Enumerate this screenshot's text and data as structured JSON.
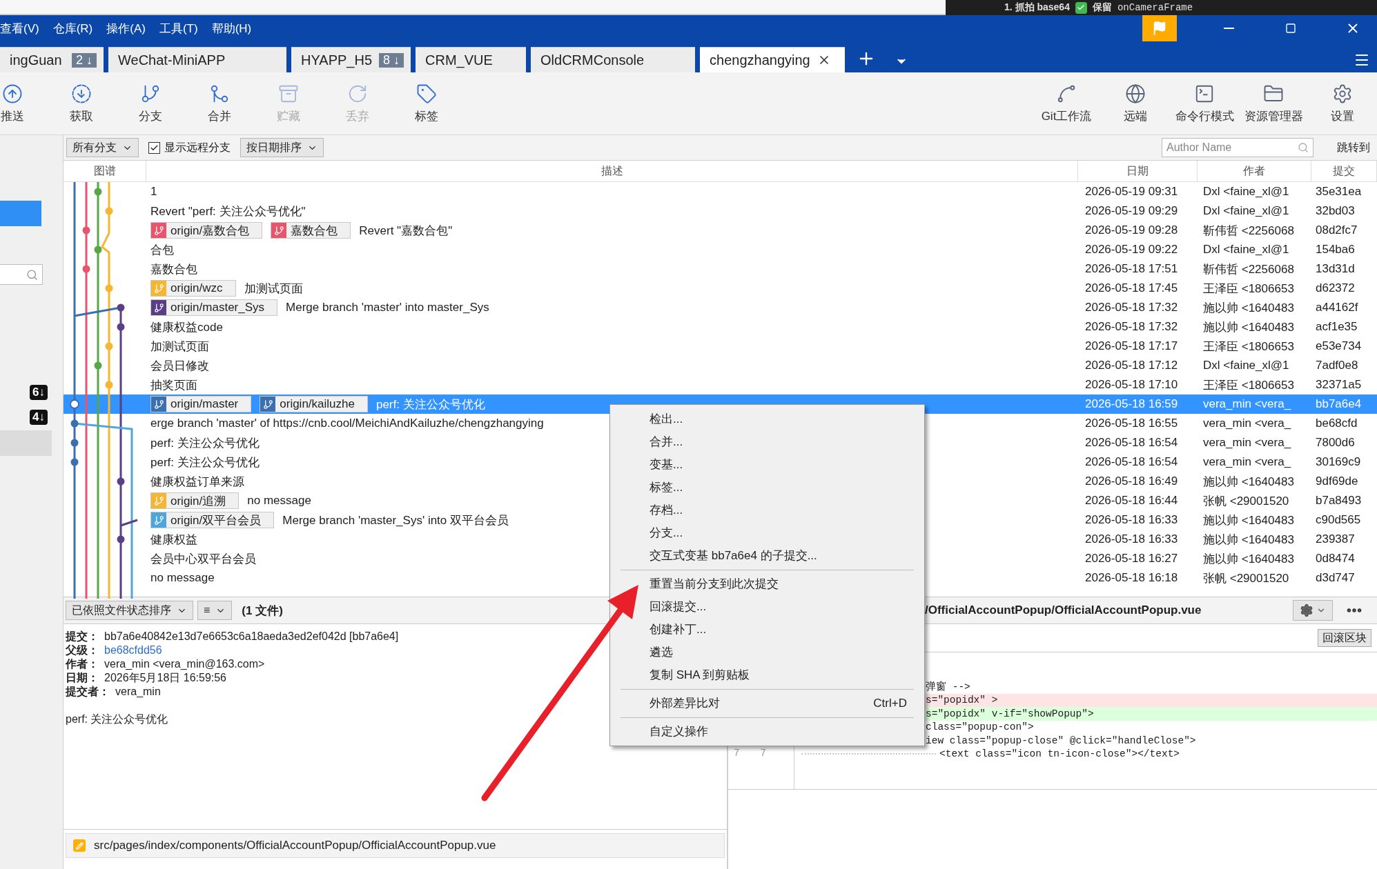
{
  "background_window": {
    "step": "1. 抓拍 base64",
    "checked": true,
    "note": "保留",
    "code": "onCameraFrame"
  },
  "menu_bar": [
    "查看(V)",
    "仓库(R)",
    "操作(A)",
    "工具(T)",
    "帮助(H)"
  ],
  "repo_tabs": [
    {
      "label": "ingGuan",
      "badge": "2 ↓",
      "selected": false
    },
    {
      "label": "WeChat-MiniAPP",
      "selected": false
    },
    {
      "label": "HYAPP_H5",
      "badge": "8 ↓",
      "selected": false
    },
    {
      "label": "CRM_VUE",
      "selected": false
    },
    {
      "label": "OldCRMConsole",
      "selected": false
    },
    {
      "label": "chengzhangying",
      "selected": true
    }
  ],
  "toolbar": {
    "left": [
      {
        "label": "推送",
        "disabled": false
      },
      {
        "label": "获取",
        "disabled": false
      },
      {
        "label": "分支",
        "disabled": false
      },
      {
        "label": "合并",
        "disabled": false
      },
      {
        "label": "贮藏",
        "disabled": true
      },
      {
        "label": "丢弃",
        "disabled": true
      },
      {
        "label": "标签",
        "disabled": false
      }
    ],
    "right": [
      {
        "label": "Git工作流",
        "disabled": false
      },
      {
        "label": "远端",
        "disabled": false
      },
      {
        "label": "命令行模式",
        "disabled": false
      },
      {
        "label": "资源管理器",
        "disabled": false
      },
      {
        "label": "设置",
        "disabled": false
      }
    ]
  },
  "sidebar": {
    "items": [
      {
        "kind": "row",
        "selected": true
      },
      {
        "kind": "search"
      },
      {
        "kind": "badge",
        "label": "6↓"
      },
      {
        "kind": "badge",
        "label": "4↓"
      },
      {
        "kind": "row",
        "selected": false
      }
    ]
  },
  "filter_bar": {
    "branches": "所有分支",
    "show_remote": {
      "label": "显示远程分支",
      "checked": true
    },
    "sort": "按日期排序",
    "author_placeholder": "Author Name",
    "jump": "跳转到"
  },
  "columns": [
    "图谱",
    "描述",
    "日期",
    "作者",
    "提交"
  ],
  "graph_lanes": [
    {
      "color": "#3a6fb0"
    },
    {
      "color": "#e8546b"
    },
    {
      "color": "#58a648"
    },
    {
      "color": "#f5b731"
    },
    {
      "color": "#5b3f86"
    },
    {
      "color": "#4ea6dc"
    }
  ],
  "commits": [
    {
      "message": "1",
      "date": "2026-05-19 09:31",
      "author": "Dxl <faine_xl@1",
      "hash": "35e31ea",
      "selected": false,
      "color": "#58a648"
    },
    {
      "message": "Revert \"perf: 关注公众号优化\"",
      "date": "2026-05-19 09:29",
      "author": "Dxl <faine_xl@1",
      "hash": "32bd03",
      "selected": false,
      "color": "#f5b731"
    },
    {
      "refs": [
        {
          "name": "origin/嘉数合包",
          "color": "#e8546b"
        },
        {
          "name": "嘉数合包",
          "color": "#e8546b"
        }
      ],
      "message": "Revert \"嘉数合包\"",
      "date": "2026-05-19 09:28",
      "author": "靳伟哲 <2256068",
      "hash": "08d2fc7",
      "selected": false,
      "color": "#e8546b"
    },
    {
      "message": "合包",
      "date": "2026-05-19 09:22",
      "author": "Dxl <faine_xl@1",
      "hash": "154ba6",
      "selected": false,
      "color": "#58a648"
    },
    {
      "message": "嘉数合包",
      "date": "2026-05-18 17:51",
      "author": "靳伟哲 <2256068",
      "hash": "13d31d",
      "selected": false,
      "color": "#e8546b"
    },
    {
      "refs": [
        {
          "name": "origin/wzc",
          "color": "#f5b731"
        }
      ],
      "message": "加测试页面",
      "date": "2026-05-18 17:45",
      "author": "王泽臣 <1806653",
      "hash": "d62372",
      "selected": false,
      "color": "#f5b731"
    },
    {
      "refs": [
        {
          "name": "origin/master_Sys",
          "color": "#5b3f86"
        }
      ],
      "message": "Merge branch 'master' into master_Sys",
      "date": "2026-05-18 17:32",
      "author": "施以帅 <1640483",
      "hash": "a44162f",
      "selected": false,
      "color": "#5b3f86"
    },
    {
      "message": "健康权益code",
      "date": "2026-05-18 17:32",
      "author": "施以帅 <1640483",
      "hash": "acf1e35",
      "selected": false,
      "color": "#5b3f86"
    },
    {
      "message": "加测试页面",
      "date": "2026-05-18 17:17",
      "author": "王泽臣 <1806653",
      "hash": "e53e734",
      "selected": false,
      "color": "#f5b731"
    },
    {
      "message": "会员日修改",
      "date": "2026-05-18 17:12",
      "author": "Dxl <faine_xl@1",
      "hash": "7adf0e8",
      "selected": false,
      "color": "#58a648"
    },
    {
      "message": "抽奖页面",
      "date": "2026-05-18 17:10",
      "author": "王泽臣 <1806653",
      "hash": "32371a5",
      "selected": false,
      "color": "#f5b731"
    },
    {
      "refs": [
        {
          "name": "origin/master",
          "color": "#3a6fb0"
        },
        {
          "name": "origin/kailuzhe",
          "color": "#3a6fb0"
        }
      ],
      "message": "perf: 关注公众号优化",
      "date": "2026-05-18 16:59",
      "author": "vera_min <vera_",
      "hash": "bb7a6e4",
      "selected": true,
      "color": "#3a6fb0"
    },
    {
      "message": "erge branch 'master' of https://cnb.cool/MeichiAndKailuzhe/chengzhangying",
      "date": "2026-05-18 16:55",
      "author": "vera_min <vera_",
      "hash": "be68cfd",
      "selected": false,
      "color": "#3a6fb0"
    },
    {
      "message": "perf: 关注公众号优化",
      "date": "2026-05-18 16:54",
      "author": "vera_min <vera_",
      "hash": "7800d6",
      "selected": false,
      "color": "#3a6fb0"
    },
    {
      "message": "perf: 关注公众号优化",
      "date": "2026-05-18 16:54",
      "author": "vera_min <vera_",
      "hash": "30169c9",
      "selected": false,
      "color": "#3a6fb0"
    },
    {
      "message": "健康权益订单来源",
      "date": "2026-05-18 16:49",
      "author": "施以帅 <1640483",
      "hash": "9df69de",
      "selected": false,
      "color": "#5b3f86"
    },
    {
      "refs": [
        {
          "name": "origin/追溯",
          "color": "#f5b731"
        }
      ],
      "message": "no message",
      "date": "2026-05-18 16:44",
      "author": "张帆 <29001520",
      "hash": "b7a8493",
      "selected": false
    },
    {
      "refs": [
        {
          "name": "origin/双平台会员",
          "color": "#4ea6dc"
        }
      ],
      "message": "Merge branch 'master_Sys' into 双平台会员",
      "date": "2026-05-18 16:33",
      "author": "施以帅 <1640483",
      "hash": "c90d565",
      "selected": false
    },
    {
      "message": "健康权益",
      "date": "2026-05-18 16:33",
      "author": "施以帅 <1640483",
      "hash": "239387",
      "selected": false,
      "color": "#5b3f86"
    },
    {
      "message": "会员中心双平台会员",
      "date": "2026-05-18 16:27",
      "author": "施以帅 <1640483",
      "hash": "0d8474",
      "selected": false
    },
    {
      "message": "no message",
      "date": "2026-05-18 16:18",
      "author": "张帆 <29001520",
      "hash": "d3d747",
      "selected": false
    }
  ],
  "details": {
    "sort": "已依照文件状态排序",
    "view": "≡",
    "count": "(1 文件)",
    "fields": [
      {
        "label": "提交：",
        "value": "bb7a6e40842e13d7e6653c6a18aeda3ed2ef042d [bb7a6e4]",
        "kind": "text"
      },
      {
        "label": "父级：",
        "value": "be68cfdd56",
        "kind": "link"
      },
      {
        "label": "作者：",
        "value": "vera_min <vera_min@163.com>",
        "kind": "text"
      },
      {
        "label": "日期：",
        "value": "2026年5月18日 16:59:56",
        "kind": "text"
      },
      {
        "label": "提交者：",
        "value": "vera_min",
        "kind": "text"
      }
    ],
    "message": "perf: 关注公众号优化",
    "files": [
      {
        "path": "src/pages/index/components/OfficialAccountPopup/OfficialAccountPopup.vue"
      }
    ]
  },
  "diff": {
    "file": "/OfficialAccountPopup/OfficialAccountPopup.vue",
    "revert_hunk": "回滚区块",
    "lines": [
      {
        "kind": "context",
        "text": "弹窗 -->"
      },
      {
        "kind": "removed",
        "text": "s=\"popidx\" >"
      },
      {
        "kind": "added",
        "text": "s=\"popidx\" v-if=\"showPopup\">"
      },
      {
        "kind": "context",
        "text": "class=\"popup-con\">"
      },
      {
        "kind": "context",
        "text": "iew class=\"popup-close\" @click=\"handleClose\">"
      },
      {
        "kind": "context",
        "old": "7",
        "new": "7",
        "text": "<text class=\"icon tn-icon-close\"></text>"
      }
    ]
  },
  "context_menu": {
    "items": [
      {
        "kind": "item",
        "label": "检出..."
      },
      {
        "kind": "item",
        "label": "合并..."
      },
      {
        "kind": "item",
        "label": "变基..."
      },
      {
        "kind": "item",
        "label": "标签..."
      },
      {
        "kind": "item",
        "label": "存档..."
      },
      {
        "kind": "item",
        "label": "分支..."
      },
      {
        "kind": "item",
        "label": "交互式变基 bb7a6e4 的子提交..."
      },
      {
        "kind": "separator"
      },
      {
        "kind": "item",
        "label": "重置当前分支到此次提交"
      },
      {
        "kind": "item",
        "label": "回滚提交..."
      },
      {
        "kind": "item",
        "label": "创建补丁..."
      },
      {
        "kind": "item",
        "label": "遴选"
      },
      {
        "kind": "item",
        "label": "复制 SHA 到剪贴板"
      },
      {
        "kind": "separator"
      },
      {
        "kind": "item",
        "label": "外部差异比对",
        "shortcut": "Ctrl+D"
      },
      {
        "kind": "separator"
      },
      {
        "kind": "item",
        "label": "自定义操作"
      }
    ]
  }
}
